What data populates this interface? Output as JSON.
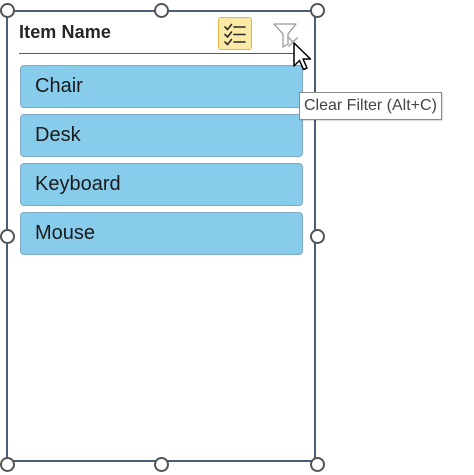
{
  "slicer": {
    "title": "Item Name",
    "items": [
      {
        "label": "Chair",
        "selected": true
      },
      {
        "label": "Desk",
        "selected": true
      },
      {
        "label": "Keyboard",
        "selected": true
      },
      {
        "label": "Mouse",
        "selected": true
      }
    ],
    "multi_select_icon": "multi-select-checklist-icon",
    "clear_filter_icon": "clear-filter-funnel-icon"
  },
  "tooltip": {
    "text": "Clear Filter (Alt+C)"
  },
  "colors": {
    "item_selected": "#88ccec",
    "multi_select_active": "#fbe9a6",
    "frame_border": "#4a5f77"
  }
}
